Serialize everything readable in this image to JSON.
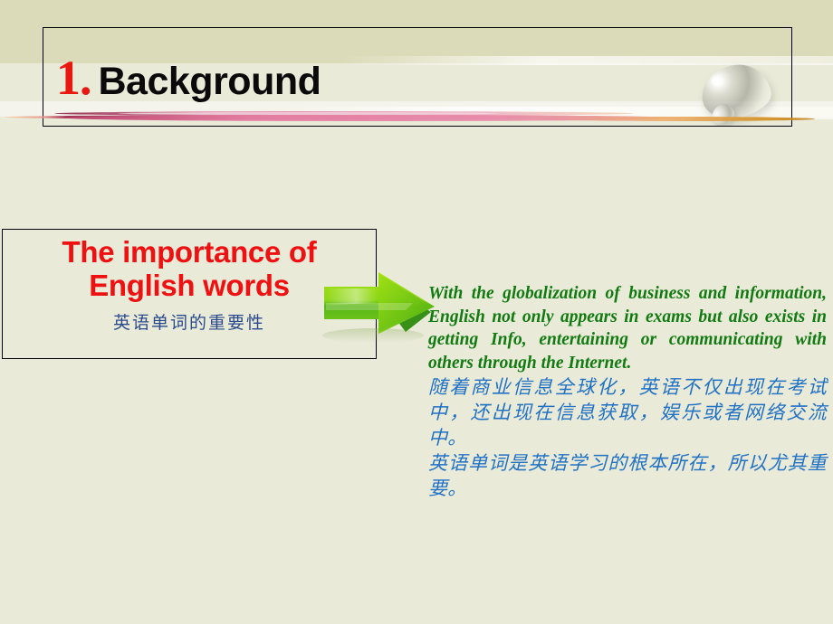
{
  "slide": {
    "header": {
      "number": "1.",
      "title": "Background"
    },
    "statement": {
      "english": "The importance of English words",
      "chinese": "英语单词的重要性"
    },
    "explanation": {
      "english": "With the globalization of business and information, English not only appears in exams but also exists in getting Info, entertaining or communicating with others through the Internet.",
      "chinese_1": "随着商业信息全球化，英语不仅出现在考试中，还出现在信息获取，娱乐或者网络交流中。",
      "chinese_2": "英语单词是英语学习的根本所在，所以尤其重要。"
    },
    "decor": {
      "arrow": "green-right-arrow",
      "droplet_large": "water-droplet",
      "droplet_small": "water-droplet",
      "swoosh": "pink-gold-swoosh"
    },
    "colors": {
      "number_red": "#e8170f",
      "title_black": "#0a0a0a",
      "statement_red": "#ef1111",
      "statement_blue": "#2a4a8c",
      "explanation_green": "#117a11",
      "explanation_blue": "#2272c4",
      "background": "#eaead9",
      "band_top": "#dcdbb9",
      "arrow_green": "#6fc41a"
    }
  }
}
